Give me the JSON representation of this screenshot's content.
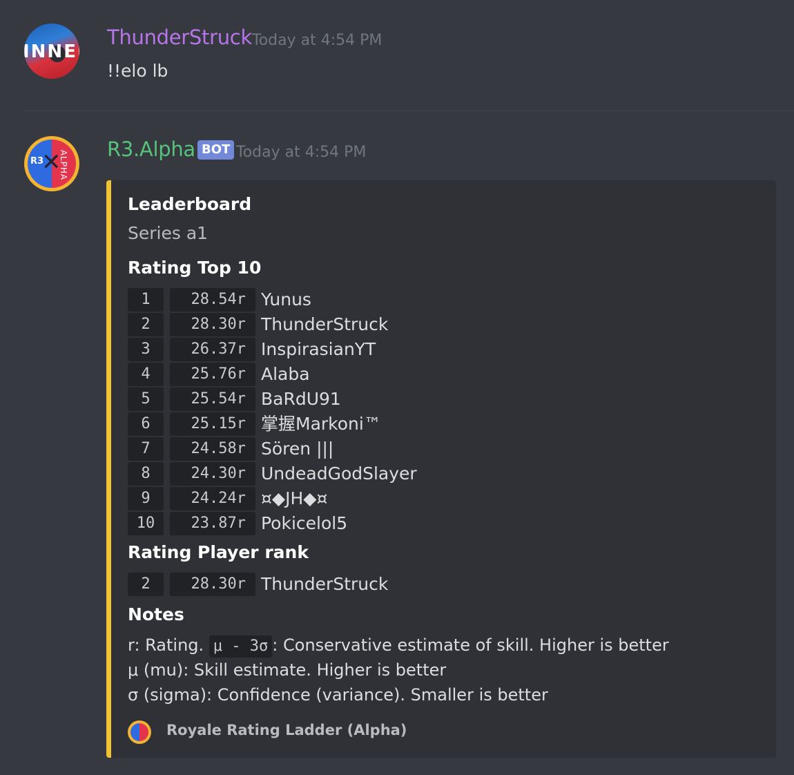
{
  "messages": [
    {
      "username": "ThunderStruck",
      "timestamp": "Today at 4:54 PM",
      "content": "!!elo lb",
      "avatar_text": "INNER"
    },
    {
      "username": "R3.Alpha",
      "bot_tag": "BOT",
      "timestamp": "Today at 4:54 PM",
      "avatar_text": {
        "r3": "R3",
        "alpha": "ALPHA"
      }
    }
  ],
  "embed": {
    "accent_color": "#f1c232",
    "title": "Leaderboard",
    "description": "Series a1",
    "top10_label": "Rating Top 10",
    "top10": [
      {
        "rank": "1",
        "score": "28.54r",
        "name": "Yunus"
      },
      {
        "rank": "2",
        "score": "28.30r",
        "name": "ThunderStruck"
      },
      {
        "rank": "3",
        "score": "26.37r",
        "name": "InspirasianYT"
      },
      {
        "rank": "4",
        "score": "25.76r",
        "name": "Alaba"
      },
      {
        "rank": "5",
        "score": "25.54r",
        "name": "BaRdU91"
      },
      {
        "rank": "6",
        "score": "25.15r",
        "name": "掌握Markoni™"
      },
      {
        "rank": "7",
        "score": "24.58r",
        "name": "Sören |||"
      },
      {
        "rank": "8",
        "score": "24.30r",
        "name": "UndeadGodSlayer"
      },
      {
        "rank": "9",
        "score": "24.24r",
        "name": "¤◆JH◆¤"
      },
      {
        "rank": "10",
        "score": "23.87r",
        "name": "Pokicelol5"
      }
    ],
    "player_rank_label": "Rating Player rank",
    "player_rank": {
      "rank": "2",
      "score": "28.30r",
      "name": "ThunderStruck"
    },
    "notes_label": "Notes",
    "notes": {
      "line1_prefix": "r: Rating. ",
      "line1_code": "μ - 3σ",
      "line1_suffix": ": Conservative estimate of skill. Higher is better",
      "line2": "μ (mu): Skill estimate. Higher is better",
      "line3": "σ (sigma): Confidence (variance). Smaller is better"
    },
    "footer": "Royale Rating Ladder (Alpha)"
  }
}
